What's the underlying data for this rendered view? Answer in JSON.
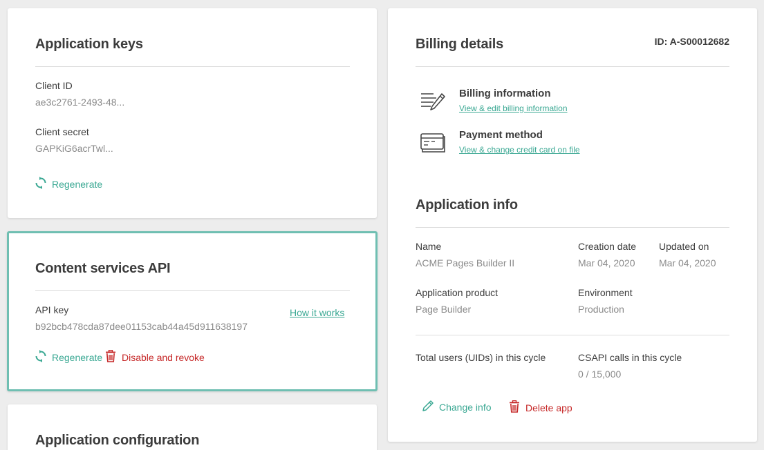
{
  "app_keys": {
    "title": "Application keys",
    "client_id_label": "Client ID",
    "client_id_value": "ae3c2761-2493-48...",
    "client_secret_label": "Client secret",
    "client_secret_value": "GAPKiG6acrTwl...",
    "regenerate_label": "Regenerate"
  },
  "content_api": {
    "title": "Content services API",
    "api_key_label": "API key",
    "api_key_value": "b92bcb478cda87dee01153cab44a45d911638197",
    "how_it_works": "How it works",
    "regenerate_label": "Regenerate",
    "disable_label": "Disable and revoke"
  },
  "app_config": {
    "title": "Application configuration"
  },
  "billing": {
    "title": "Billing details",
    "id_text": "ID: A-S00012682",
    "billing_info_title": "Billing information",
    "billing_info_link": "View & edit billing information",
    "payment_title": "Payment method",
    "payment_link": "View & change credit card on file"
  },
  "app_info": {
    "title": "Application info",
    "name_label": "Name",
    "name_value": "ACME Pages Builder II",
    "creation_label": "Creation date",
    "creation_value": "Mar 04, 2020",
    "updated_label": "Updated on",
    "updated_value": "Mar 04, 2020",
    "product_label": "Application product",
    "product_value": "Page Builder",
    "env_label": "Environment",
    "env_value": "Production",
    "users_label": "Total users (UIDs) in this cycle",
    "csapi_label": "CSAPI calls in this cycle",
    "csapi_value": "0 / 15,000",
    "change_info": "Change info",
    "delete_app": "Delete app"
  },
  "icons": {
    "regenerate": "refresh-icon",
    "trash": "trash-icon",
    "billing": "document-pen-icon",
    "payment": "credit-card-icon",
    "edit": "pencil-icon"
  },
  "colors": {
    "accent": "#3aa893",
    "danger": "#c62828",
    "highlight_border": "#6fbfb2"
  }
}
